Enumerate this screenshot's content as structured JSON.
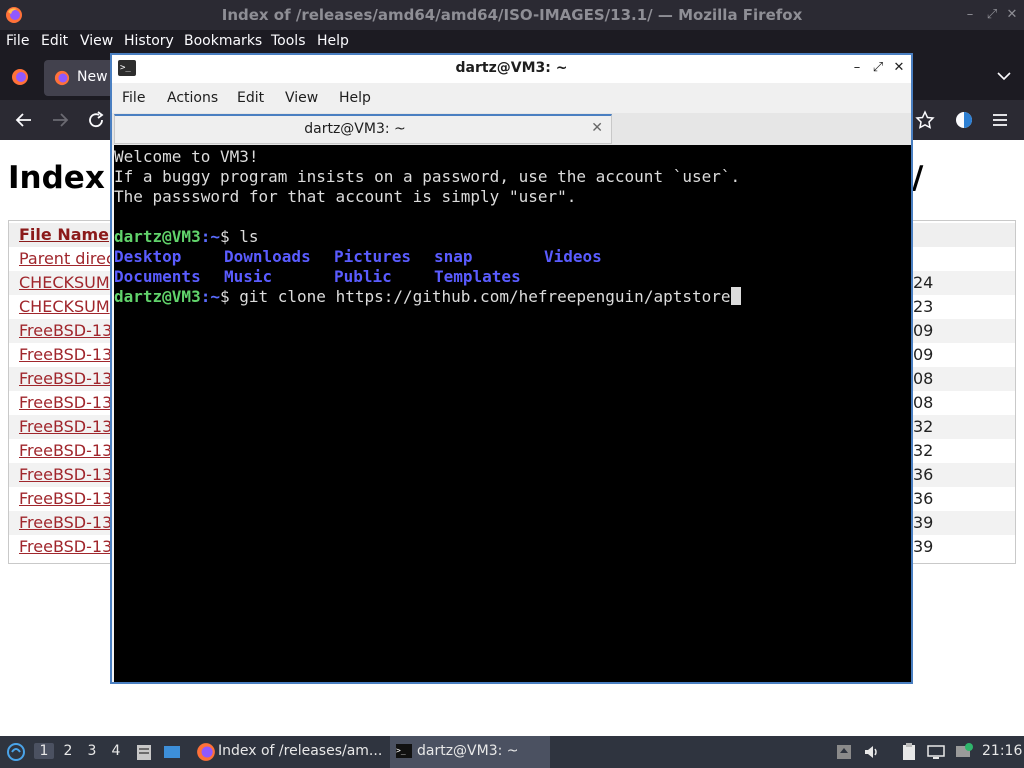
{
  "firefox": {
    "window_title": "Index of /releases/amd64/amd64/ISO-IMAGES/13.1/ — Mozilla Firefox",
    "menu": [
      "File",
      "Edit",
      "View",
      "History",
      "Bookmarks",
      "Tools",
      "Help"
    ],
    "tab_label": "New",
    "page": {
      "heading": "Index",
      "heading_tail": "/",
      "column_header": "File Name",
      "rows": [
        {
          "name": "Parent direc",
          "date": ""
        },
        {
          "name": "CHECKSUM",
          "date": "24"
        },
        {
          "name": "CHECKSUM",
          "date": "23"
        },
        {
          "name": "FreeBSD-13",
          "date": "09"
        },
        {
          "name": "FreeBSD-13",
          "date": "09"
        },
        {
          "name": "FreeBSD-13",
          "date": "08"
        },
        {
          "name": "FreeBSD-13",
          "date": "08"
        },
        {
          "name": "FreeBSD-13",
          "date": "32"
        },
        {
          "name": "FreeBSD-13",
          "date": "32"
        },
        {
          "name": "FreeBSD-13",
          "date": "36"
        },
        {
          "name": "FreeBSD-13",
          "date": "36"
        },
        {
          "name": "FreeBSD-13",
          "date": "39"
        },
        {
          "name": "FreeBSD-13",
          "date": "39"
        }
      ]
    }
  },
  "terminal": {
    "window_title": "dartz@VM3: ~",
    "menu": [
      "File",
      "Actions",
      "Edit",
      "View",
      "Help"
    ],
    "tab_label": "dartz@VM3: ~",
    "welcome": [
      "Welcome to VM3!",
      "If a buggy program insists on a password, use the account `user`.",
      "The passsword for that account is simply \"user\"."
    ],
    "prompt_user": "dartz@VM3",
    "prompt_path": ":~",
    "prompt_sign": "$ ",
    "cmd1": "ls",
    "ls_row1": [
      "Desktop",
      "Downloads",
      "Pictures",
      "snap",
      "Videos"
    ],
    "ls_row2": [
      "Documents",
      "Music",
      "Public",
      "Templates"
    ],
    "cmd2": "git clone https://github.com/hefreepenguin/aptstore"
  },
  "taskbar": {
    "workspaces": [
      "1",
      "2",
      "3",
      "4"
    ],
    "tasks": [
      "Index of /releases/am...",
      "dartz@VM3: ~"
    ],
    "clock": "21:16"
  }
}
